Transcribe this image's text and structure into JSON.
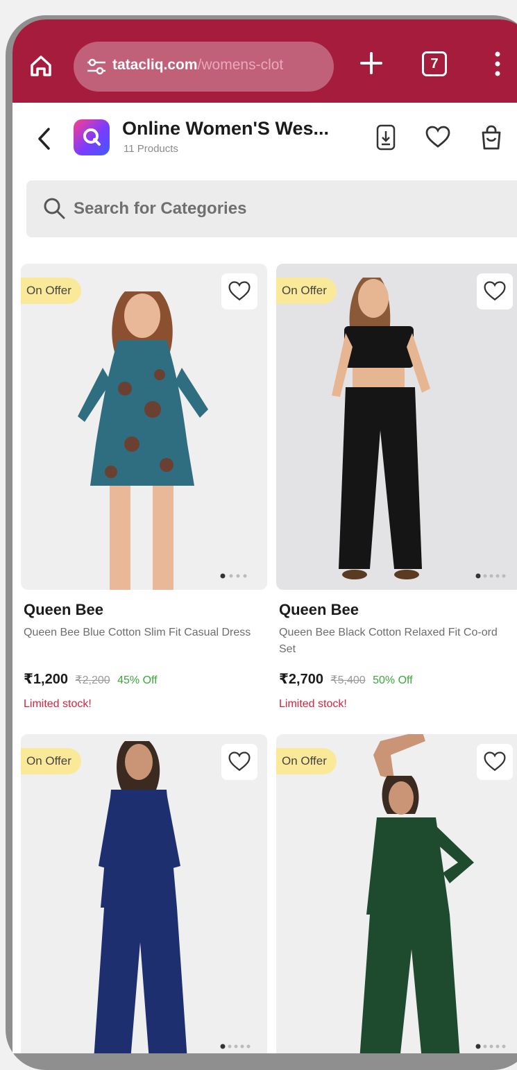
{
  "browser": {
    "url_domain": "tatacliq.com",
    "url_rest": "/womens-clot",
    "tab_count": "7"
  },
  "header": {
    "title": "Online Women'S Wes...",
    "subtitle": "11 Products"
  },
  "search": {
    "placeholder": "Search for Categories"
  },
  "products": [
    {
      "badge": "On Offer",
      "brand": "Queen Bee",
      "name": "Queen Bee Blue Cotton Slim Fit Casual Dress",
      "price": "₹1,200",
      "mrp": "₹2,200",
      "discount": "45% Off",
      "stock": "Limited stock!"
    },
    {
      "badge": "On Offer",
      "brand": "Queen Bee",
      "name": "Queen Bee Black Cotton Relaxed Fit Co-ord Set",
      "price": "₹2,700",
      "mrp": "₹5,400",
      "discount": "50% Off",
      "stock": "Limited stock!"
    },
    {
      "badge": "On Offer"
    },
    {
      "badge": "On Offer"
    }
  ],
  "colors": {
    "browser_bar": "#a51c3c",
    "offer_badge": "#fbe99a",
    "discount": "#3aa63a",
    "stock_warning": "#d6233b"
  },
  "icons": [
    "home-icon",
    "site-settings-icon",
    "plus-icon",
    "tabs-icon",
    "more-icon",
    "back-icon",
    "app-logo-icon",
    "download-app-icon",
    "heart-icon",
    "bag-icon",
    "search-icon",
    "wishlist-icon"
  ]
}
